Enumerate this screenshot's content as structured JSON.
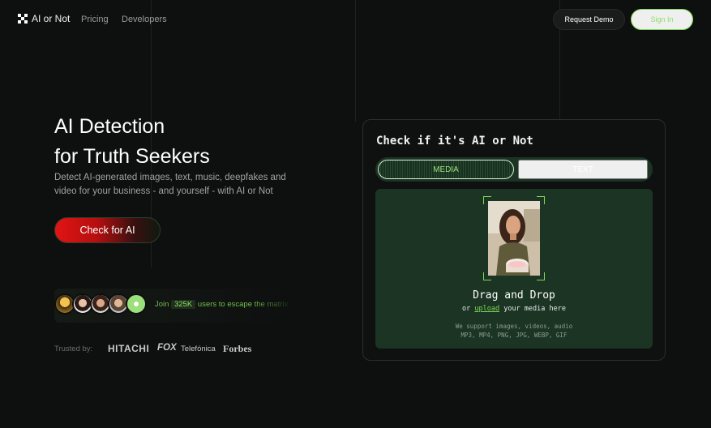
{
  "nav": {
    "logo_text": "AI or Not",
    "links": [
      "Pricing",
      "Developers"
    ],
    "request_demo": "Request Demo",
    "sign_in": "Sign In"
  },
  "hero": {
    "title_line1": "AI Detection",
    "title_line2": "for Truth Seekers",
    "subtitle": "Detect AI-generated images, text, music, deepfakes and video for your business - and yourself - with AI or Not",
    "cta": "Check for AI"
  },
  "proof": {
    "prefix": "Join",
    "count": "325K",
    "suffix": "users to escape the matrix"
  },
  "trusted": {
    "label": "Trusted by:",
    "brands": [
      "HITACHI",
      "FOX",
      "Telefónica",
      "Forbes"
    ]
  },
  "card": {
    "title": "Check if it's AI or Not",
    "tabs": [
      "MEDIA",
      "TEXT"
    ],
    "active_tab": "MEDIA",
    "drop_title": "Drag and Drop",
    "drop_or": "or",
    "drop_upload": "upload",
    "drop_rest": "your media here",
    "support_line1": "We support images, videos, audio",
    "support_line2": "MP3, MP4, PNG, JPG, WEBP, GIF"
  },
  "colors": {
    "background": "#0e0f0f",
    "accent_green": "#7ed957",
    "panel_green": "#1b3424",
    "cta_red": "#e11414"
  },
  "icons": {
    "logo": "logo-icon"
  }
}
